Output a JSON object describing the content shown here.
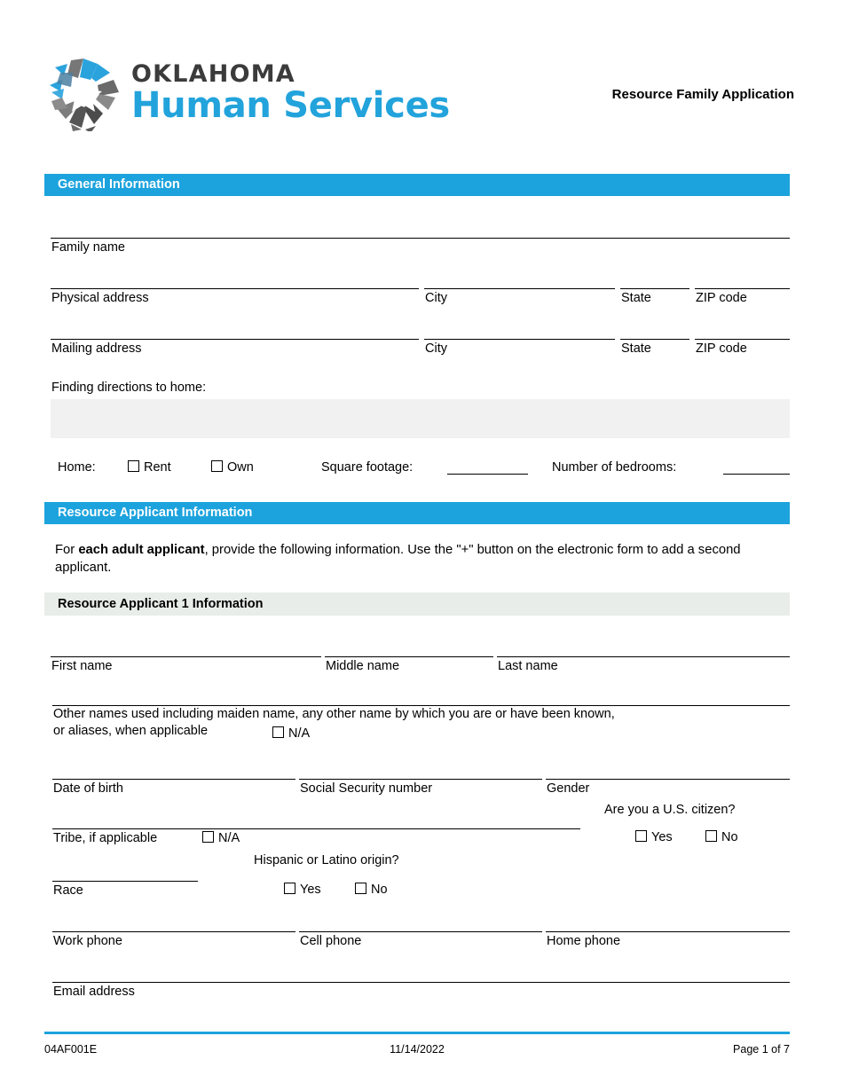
{
  "brand": {
    "logo_line1": "OKLAHOMA",
    "logo_line2": "Human Services",
    "accent_color": "#1CA3DD",
    "gray_color": "#7A7A7A",
    "logo_icon": "pinwheel-star-logo"
  },
  "header": {
    "document_title": "Resource Family Application"
  },
  "sections": {
    "general": {
      "title": "General Information",
      "fields": {
        "family_name": "Family name",
        "physical_address": "Physical address",
        "mailing_address": "Mailing address",
        "city": "City",
        "state": "State",
        "zip_code": "ZIP code",
        "directions_label": "Finding directions to home:",
        "directions_value": ""
      },
      "home": {
        "label": "Home:",
        "rent": "Rent",
        "own": "Own",
        "rent_checked": false,
        "own_checked": false,
        "square_footage_label": "Square footage:",
        "square_footage_value": "",
        "bedrooms_label": "Number of bedrooms:",
        "bedrooms_value": ""
      }
    },
    "applicant": {
      "title": "Resource Applicant Information",
      "instruction_prefix": "For ",
      "instruction_bold": "each adult applicant",
      "instruction_suffix": ", provide the following information. Use the \"+\" button on the electronic form to add a second applicant.",
      "subsection_title": "Resource Applicant 1 Information",
      "fields": {
        "first_name": "First name",
        "middle_name": "Middle name",
        "last_name": "Last name",
        "other_names_line1": "Other names used including maiden name, any other name by which you are or have been known,",
        "other_names_line2": "or aliases, when applicable",
        "other_names_na": "N/A",
        "other_names_na_checked": false,
        "date_of_birth": "Date of birth",
        "ssn": "Social Security number",
        "gender": "Gender",
        "citizen_question": "Are you a U.S. citizen?",
        "citizen_yes": "Yes",
        "citizen_no": "No",
        "citizen_yes_checked": false,
        "citizen_no_checked": false,
        "tribe": "Tribe, if applicable",
        "tribe_na": "N/A",
        "tribe_na_checked": false,
        "hispanic_question": "Hispanic or Latino origin?",
        "hispanic_yes": "Yes",
        "hispanic_no": "No",
        "hispanic_yes_checked": false,
        "hispanic_no_checked": false,
        "race": "Race",
        "work_phone": "Work phone",
        "cell_phone": "Cell phone",
        "home_phone": "Home phone",
        "email_address": "Email address"
      }
    }
  },
  "footer": {
    "form_number": "04AF001E",
    "revision_date": "11/14/2022",
    "page_label": "Page 1 of 7"
  }
}
